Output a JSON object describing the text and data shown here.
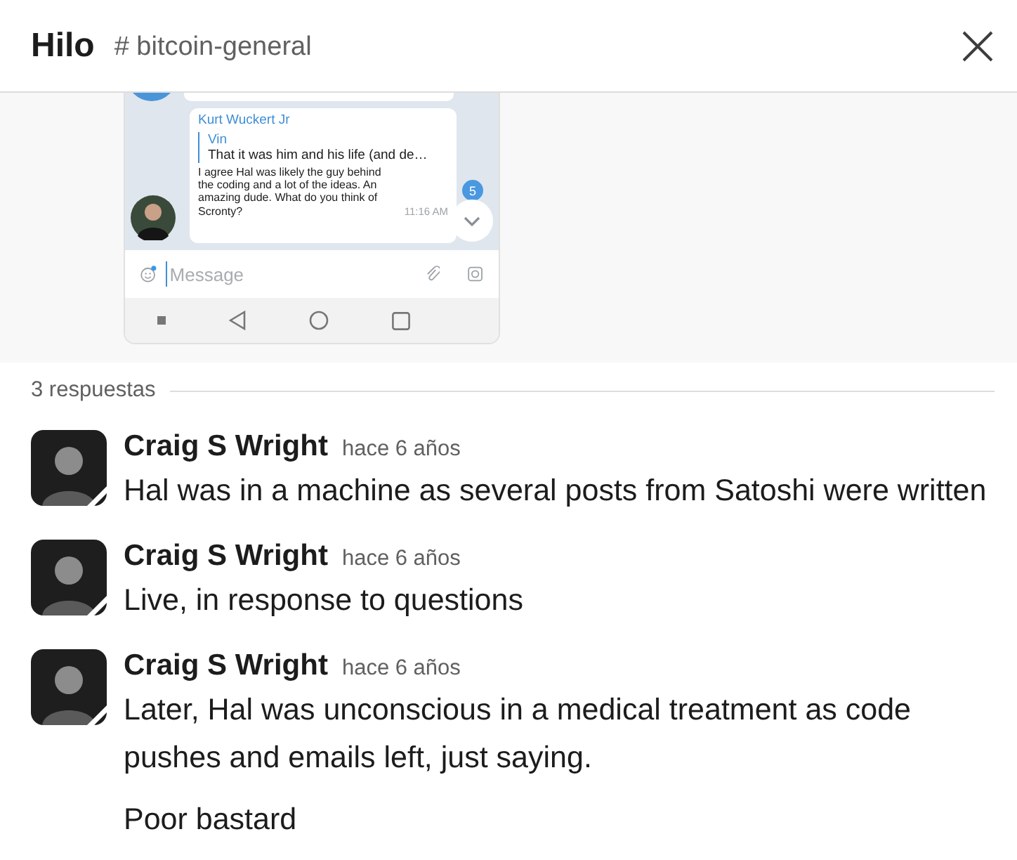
{
  "header": {
    "title": "Hilo",
    "channel": "# bitcoin-general"
  },
  "attachment": {
    "kind": "phone_screenshot",
    "message": {
      "sender": "Kurt Wuckert Jr",
      "reply_author": "Vin",
      "reply_text": "That it was him and his life (and de…",
      "text": "I agree Hal was likely the guy behind\nthe coding and a lot of the ideas. An\namazing dude. What do you think of\nScronty?",
      "time": "11:16 AM"
    },
    "unread_badge": "5",
    "composer": {
      "placeholder": "Message"
    }
  },
  "replies_count": "3 respuestas",
  "messages": [
    {
      "author": "Craig S Wright",
      "time": "hace 6 años",
      "paragraphs": [
        "Hal was in a machine as several posts from Satoshi were written"
      ]
    },
    {
      "author": "Craig S Wright",
      "time": "hace 6 años",
      "paragraphs": [
        "Live, in response to questions"
      ]
    },
    {
      "author": "Craig S Wright",
      "time": "hace 6 años",
      "paragraphs": [
        "Later, Hal was unconscious in a medical treatment as code pushes and emails left, just saying.",
        "Poor bastard"
      ]
    }
  ]
}
